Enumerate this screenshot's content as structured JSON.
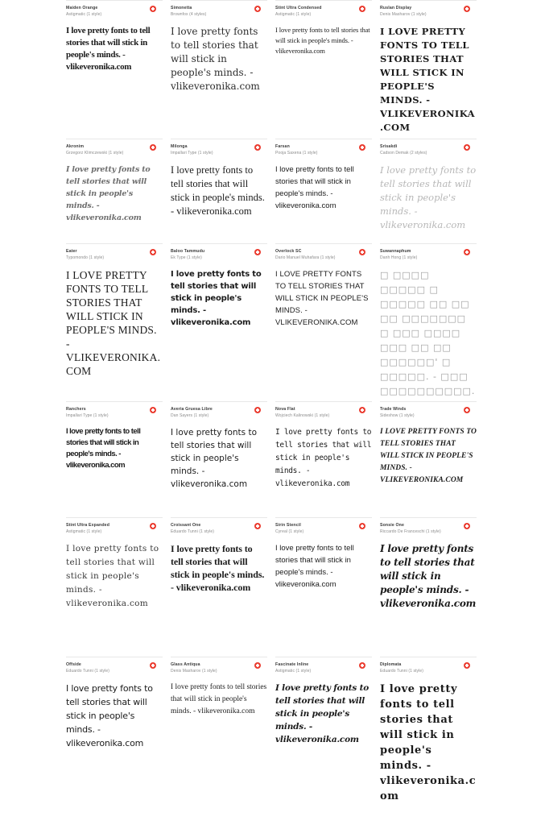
{
  "theme": {
    "background": "#ffffff",
    "text_color": "#1b1b1b",
    "name_color": "#3a3a3a",
    "meta_color": "#8a8a8a",
    "accent": "#eb3f33",
    "divider": "#e8e8e8"
  },
  "specimen_text": "I love pretty fonts to tell stories that will stick in people's minds. - vlikeveronika.com",
  "add_icon": "plus-circle-icon",
  "cards": [
    {
      "name": "Maiden Orange",
      "meta": "Astigmatic (1 style)",
      "style_class": "sp-maiden-orange",
      "sample": "I love pretty fonts to tell stories that will stick in people's minds. - vlikeveronika.com"
    },
    {
      "name": "Simonetta",
      "meta": "Brownfox (4 styles)",
      "style_class": "sp-simonetta",
      "sample": "I love pretty fonts to tell stories that will stick in people's minds. - vlikeveronika.com"
    },
    {
      "name": "Stint Ultra Condensed",
      "meta": "Astigmatic (1 style)",
      "style_class": "sp-stint-cond",
      "sample": "I love pretty fonts to tell stories that will stick in people's minds. - vlikeveronika.com"
    },
    {
      "name": "Ruslan Display",
      "meta": "Denis Masharov (1 style)",
      "style_class": "sp-ruslan",
      "sample": "I love pretty fonts to tell stories that will stick in people's minds. - vlikeveronika.com"
    },
    {
      "name": "Akronim",
      "meta": "Grzegorz Klimczewski (1 style)",
      "style_class": "sp-akronim",
      "sample": "I love pretty fonts to tell stories that will stick in people's minds. - vlikeveronika.com"
    },
    {
      "name": "Milonga",
      "meta": "Impallari Type (1 style)",
      "style_class": "sp-milonga",
      "sample": "I love pretty fonts to tell stories that will stick in people's minds. - vlikeveronika.com"
    },
    {
      "name": "Farsan",
      "meta": "Pooja Saxena (1 style)",
      "style_class": "sp-farsan",
      "sample": "I love pretty fonts to tell stories that will stick in people's minds. - vlikeveronika.com"
    },
    {
      "name": "Srisakdi",
      "meta": "Cadson Demak (2 styles)",
      "style_class": "sp-srisakdi",
      "sample": "I love pretty fonts to tell stories that will stick in people's minds. - vlikeveronika.com"
    },
    {
      "name": "Eater",
      "meta": "Typomondo (1 style)",
      "style_class": "sp-eater",
      "sample": "I love pretty fonts to tell stories that will stick in people's minds. - vlikeveronika.com"
    },
    {
      "name": "Baloo Tammudu",
      "meta": "Ek Type (1 style)",
      "style_class": "sp-baloo",
      "sample": "I love pretty fonts to tell stories that will stick in people's minds. - vlikeveronika.com"
    },
    {
      "name": "Overlock SC",
      "meta": "Dario Manuel Muhafara (1 style)",
      "style_class": "sp-overlock",
      "sample": "I love pretty fonts to tell stories that will stick in people's minds. - vlikeveronika.com"
    },
    {
      "name": "Suwannaphum",
      "meta": "Danh Hong (1 style)",
      "style_class": "sp-suwannaphum",
      "sample": "□ □□□□ □□□□□ □ □□□□□ □□ □□ □□ □□□□□□□ □ □□□ □□□□ □□□ □□ □□ □□□□□□' □ □□□□□. - □□□ □□□□□□□□□□.□ □□"
    },
    {
      "name": "Ranchers",
      "meta": "Impallari Type (1 style)",
      "style_class": "sp-ranchers",
      "sample": "I love pretty fonts to tell stories that will stick in people's minds. - vlikeveronika.com"
    },
    {
      "name": "Averia Gruesa Libre",
      "meta": "Dan Sayers (1 style)",
      "style_class": "sp-averia",
      "sample": "I love pretty fonts to tell stories that will stick in people's minds. - vlikeveronika.com"
    },
    {
      "name": "Nova Flat",
      "meta": "Wojciech Kalinowski (1 style)",
      "style_class": "sp-nova-flat",
      "sample": "I love pretty fonts to tell stories that will stick in people's minds. - vlikeveronika.com"
    },
    {
      "name": "Trade Winds",
      "meta": "Sideshow (1 style)",
      "style_class": "sp-trade-winds",
      "sample": "I love pretty fonts to tell stories that will stick in people's minds. - vlikeveronika.com"
    },
    {
      "name": "Stint Ultra Expanded",
      "meta": "Astigmatic (1 style)",
      "style_class": "sp-stint-exp",
      "sample": "I love pretty fonts to tell stories that will stick in people's minds. - vlikeveronika.com"
    },
    {
      "name": "Croissant One",
      "meta": "Eduardo Tunni (1 style)",
      "style_class": "sp-croissant",
      "sample": "I love pretty fonts to tell stories that will stick in people's minds. - vlikeveronika.com"
    },
    {
      "name": "Sirin Stencil",
      "meta": "Cyreal (1 style)",
      "style_class": "sp-sirin",
      "sample": "I love pretty fonts to tell stories that will stick in people's minds. - vlikeveronika.com"
    },
    {
      "name": "Sonsie One",
      "meta": "Riccardo De Franceschi (1 style)",
      "style_class": "sp-sonsie",
      "sample": "I love pretty fonts to tell stories that will stick in people's minds. - vlikeveronika.com"
    },
    {
      "name": "Offside",
      "meta": "Eduardo Tunni (1 style)",
      "style_class": "sp-offside",
      "sample": "I love pretty fonts to tell stories that will stick in people's minds. - vlikeveronika.com"
    },
    {
      "name": "Glass Antiqua",
      "meta": "Denis Masharov (1 style)",
      "style_class": "sp-glass-antiqua",
      "sample": "I love pretty fonts to tell stories that will stick in people's minds. - vlikeveronika.com"
    },
    {
      "name": "Fascinate Inline",
      "meta": "Astigmatic (1 style)",
      "style_class": "sp-fascinate",
      "sample": "I love pretty fonts to tell stories that will stick in people's minds. - vlikeveronika.com"
    },
    {
      "name": "Diplomata",
      "meta": "Eduardo Tunni (1 style)",
      "style_class": "sp-diplomata",
      "sample": "I love pretty fonts to tell stories that will stick in people's minds. - vlikeveronika.com"
    }
  ]
}
